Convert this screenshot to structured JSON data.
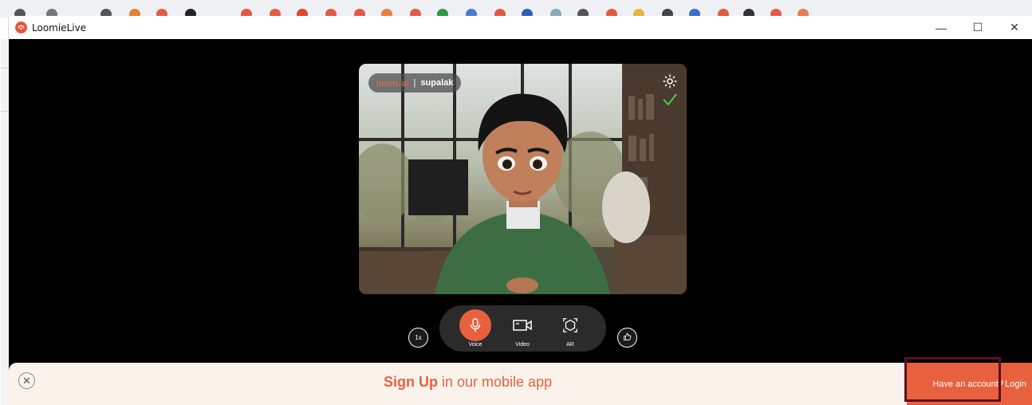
{
  "window": {
    "app_title": "LoomieLive",
    "minimize_label": "—",
    "maximize_label": "☐",
    "close_label": "✕"
  },
  "stream": {
    "brand": "loom.ai",
    "separator": "|",
    "username": "supalak"
  },
  "controls": {
    "speed_label": "1x",
    "voice_label": "Voice",
    "video_label": "Video",
    "ar_label": "AR"
  },
  "banner": {
    "close_label": "✕",
    "signup_strong": "Sign Up",
    "signup_rest": " in our mobile app",
    "have_account": "Have an account?",
    "login": "Login"
  },
  "colors": {
    "accent": "#e8613f",
    "banner_bg": "#f9f3ec",
    "controls_bg": "#2b2b2b",
    "highlight": "#5c0f22"
  }
}
